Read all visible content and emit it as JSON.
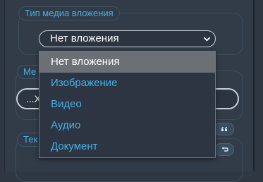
{
  "media_type": {
    "legend": "Тип медиа вложения",
    "selected_value": "Нет вложения",
    "options": [
      "Нет вложения",
      "Изображение",
      "Видео",
      "Аудио",
      "Документ"
    ]
  },
  "media_group": {
    "legend_visible": "Ме",
    "field_value": "...X"
  },
  "text_group": {
    "legend_visible": "Тек"
  },
  "icons": {
    "quote_button": "quote-icon",
    "undo_button": "undo-icon",
    "chevron": "chevron-down-icon"
  },
  "colors": {
    "accent": "#46b0e8",
    "background": "#323b48",
    "selected_option": "#6b7077"
  }
}
